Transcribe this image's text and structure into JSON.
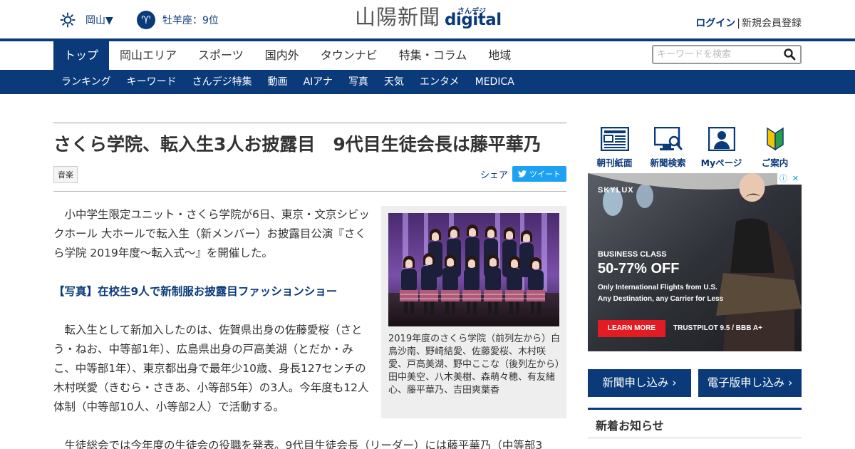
{
  "header": {
    "weather_region": "岡山▼",
    "horoscope": "牡羊座：9位",
    "logo_main": "山陽新聞",
    "logo_small": "さんデジ",
    "logo_digital": "digital",
    "login": "ログイン",
    "separator": "|",
    "register": "新規会員登録"
  },
  "mainnav": {
    "items": [
      "トップ",
      "岡山エリア",
      "スポーツ",
      "国内外",
      "タウンナビ",
      "特集・コラム",
      "地域"
    ],
    "search_placeholder": "キーワードを検索"
  },
  "subnav": {
    "items": [
      "ランキング",
      "キーワード",
      "さんデジ特集",
      "動画",
      "AIアナ",
      "写真",
      "天気",
      "エンタメ",
      "MEDICA"
    ]
  },
  "article": {
    "headline": "さくら学院、転入生3人お披露目　9代目生徒会長は藤平華乃",
    "tag": "音楽",
    "share_label": "シェア",
    "tweet_label": "ツイート",
    "para1": "小中学生限定ユニット・さくら学院が6日、東京・文京シビックホール 大ホールで転入生（新メンバー）お披露目公演『さくら学院 2019年度～転入式～』を開催した。",
    "photo_link": "【写真】在校生9人で新制服お披露目ファッションショー",
    "para2": "転入生として新加入したのは、佐賀県出身の佐藤愛桜（さとう・ねお、中等部1年）、広島県出身の戸高美湖（とだか・みこ、中等部1年）、東京都出身で最年少10歳、身長127センチの木村咲愛（きむら・さきあ、小等部5年）の3人。今年度も12人体制（中等部10人、小等部2人）で活動する。",
    "para3": "生徒総会では今年度の生徒会の役職を発表。9代目生徒会長（リーダー）には藤平華乃（中等部3",
    "caption": "2019年度のさくら学院（前列左から）白鳥沙南、野崎結愛、佐藤愛桜、木村咲愛、戸高美湖、野中ここな（後列左から）田中美空、八木美樹、森萌々穂、有友緒心、藤平華乃、吉田爽葉香"
  },
  "sidebar": {
    "icons": [
      {
        "label": "朝刊紙面",
        "icon": "newspaper-icon"
      },
      {
        "label": "新聞検索",
        "icon": "monitor-search-icon"
      },
      {
        "label": "Myページ",
        "icon": "person-icon"
      },
      {
        "label": "ご案内",
        "icon": "beginner-mark-icon"
      }
    ],
    "ad": {
      "brand": "SKYLUX",
      "line1": "BUSINESS CLASS",
      "line2": "50-77% OFF",
      "line3": "Only International Flights from U.S.",
      "line4": "Any Destination, any Carrier for Less",
      "cta": "LEARN MORE",
      "trust": "TRUSTPILOT 9.5 / BBB A+"
    },
    "subscribe_paper": "新聞申し込み ›",
    "subscribe_digital": "電子版申し込み ›",
    "news_title": "新着お知らせ"
  },
  "colors": {
    "brand_navy": "#0a3a7a",
    "twitter": "#1da1f2",
    "ad_red": "#e31b23"
  }
}
